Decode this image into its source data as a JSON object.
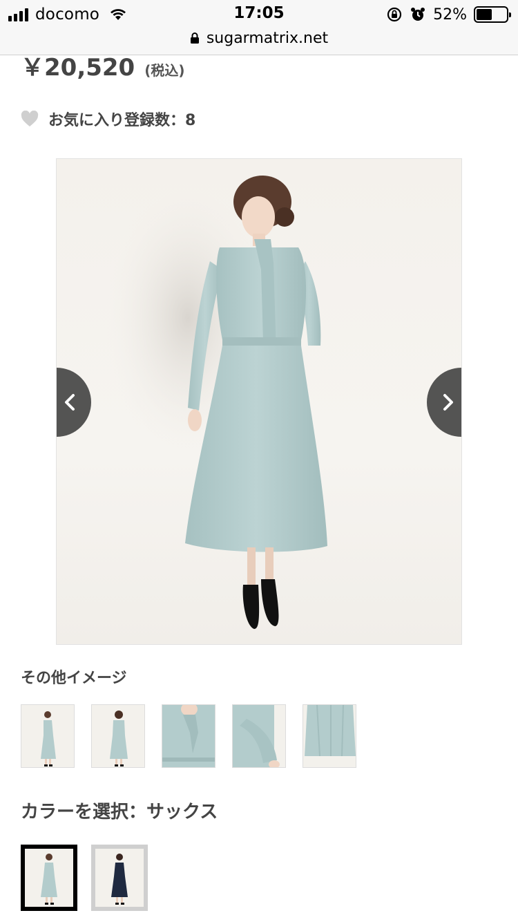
{
  "status_bar": {
    "carrier": "docomo",
    "time": "17:05",
    "battery_percent": "52%",
    "battery_level": 0.52
  },
  "browser": {
    "url": "sugarmatrix.net"
  },
  "product": {
    "price": "￥20,520",
    "tax_note": "(税込)",
    "favorites_label": "お気に入り登録数：8"
  },
  "gallery": {
    "other_images_title": "その他イメージ",
    "thumbnails": [
      "front-full",
      "back-full",
      "collar-closeup",
      "sleeve-closeup",
      "skirt-closeup"
    ]
  },
  "color_selector": {
    "title": "カラーを選択：サックス",
    "options": [
      {
        "name": "サックス",
        "color": "#b3cccc",
        "selected": true
      },
      {
        "name": "navy",
        "color": "#1f2a40",
        "selected": false
      }
    ]
  },
  "colors": {
    "dress": "#b5cdcd",
    "arrow_bg": "#373737"
  },
  "icons": {
    "heart": "heart-icon",
    "lock": "lock-icon",
    "prev": "chevron-left-icon",
    "next": "chevron-right-icon"
  }
}
